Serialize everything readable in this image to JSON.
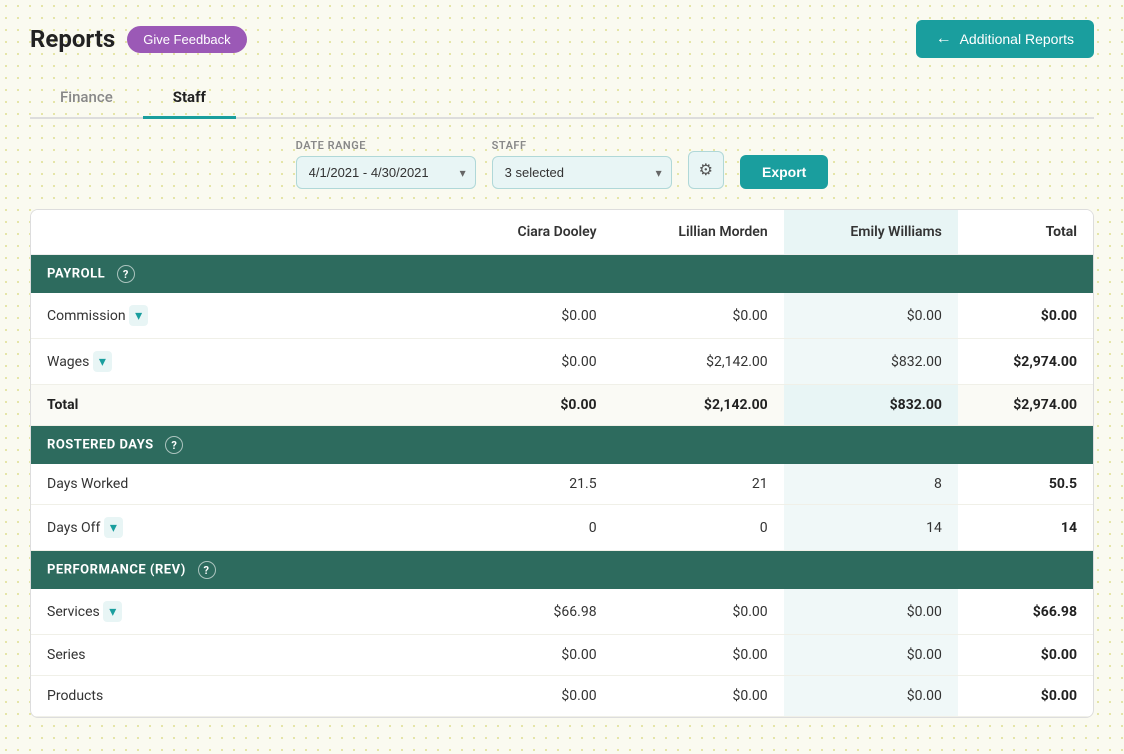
{
  "page": {
    "title": "Reports",
    "feedback_btn": "Give Feedback",
    "additional_reports_btn": "Additional Reports"
  },
  "tabs": [
    {
      "id": "finance",
      "label": "Finance",
      "active": false
    },
    {
      "id": "staff",
      "label": "Staff",
      "active": true
    }
  ],
  "filters": {
    "date_range_label": "DATE RANGE",
    "date_range_value": "4/1/2021 - 4/30/2021",
    "staff_label": "STAFF",
    "staff_value": "3 selected",
    "export_label": "Export"
  },
  "table": {
    "columns": [
      {
        "id": "label",
        "label": ""
      },
      {
        "id": "ciara",
        "label": "Ciara Dooley"
      },
      {
        "id": "lillian",
        "label": "Lillian Morden"
      },
      {
        "id": "emily",
        "label": "Emily Williams"
      },
      {
        "id": "total",
        "label": "Total"
      }
    ],
    "sections": [
      {
        "id": "payroll",
        "header": "PAYROLL",
        "rows": [
          {
            "label": "Commission",
            "has_dropdown": true,
            "ciara": "$0.00",
            "lillian": "$0.00",
            "emily": "$0.00",
            "total": "$0.00"
          },
          {
            "label": "Wages",
            "has_dropdown": true,
            "ciara": "$0.00",
            "lillian": "$2,142.00",
            "emily": "$832.00",
            "total": "$2,974.00"
          }
        ],
        "total_row": {
          "label": "Total",
          "ciara": "$0.00",
          "lillian": "$2,142.00",
          "emily": "$832.00",
          "total": "$2,974.00"
        }
      },
      {
        "id": "rostered_days",
        "header": "ROSTERED DAYS",
        "rows": [
          {
            "label": "Days Worked",
            "has_dropdown": false,
            "ciara": "21.5",
            "lillian": "21",
            "emily": "8",
            "total": "50.5"
          },
          {
            "label": "Days Off",
            "has_dropdown": true,
            "ciara": "0",
            "lillian": "0",
            "emily": "14",
            "total": "14"
          }
        ],
        "total_row": null
      },
      {
        "id": "performance_rev",
        "header": "PERFORMANCE (REV)",
        "rows": [
          {
            "label": "Services",
            "has_dropdown": true,
            "ciara": "$66.98",
            "lillian": "$0.00",
            "emily": "$0.00",
            "total": "$66.98"
          },
          {
            "label": "Series",
            "has_dropdown": false,
            "ciara": "$0.00",
            "lillian": "$0.00",
            "emily": "$0.00",
            "total": "$0.00"
          },
          {
            "label": "Products",
            "has_dropdown": false,
            "ciara": "$0.00",
            "lillian": "$0.00",
            "emily": "$0.00",
            "total": "$0.00"
          }
        ],
        "total_row": null
      }
    ]
  },
  "icons": {
    "arrow_left": "←",
    "chevron_down": "▾",
    "question_mark": "?",
    "gear": "⚙",
    "dropdown_arrow": "▾"
  }
}
